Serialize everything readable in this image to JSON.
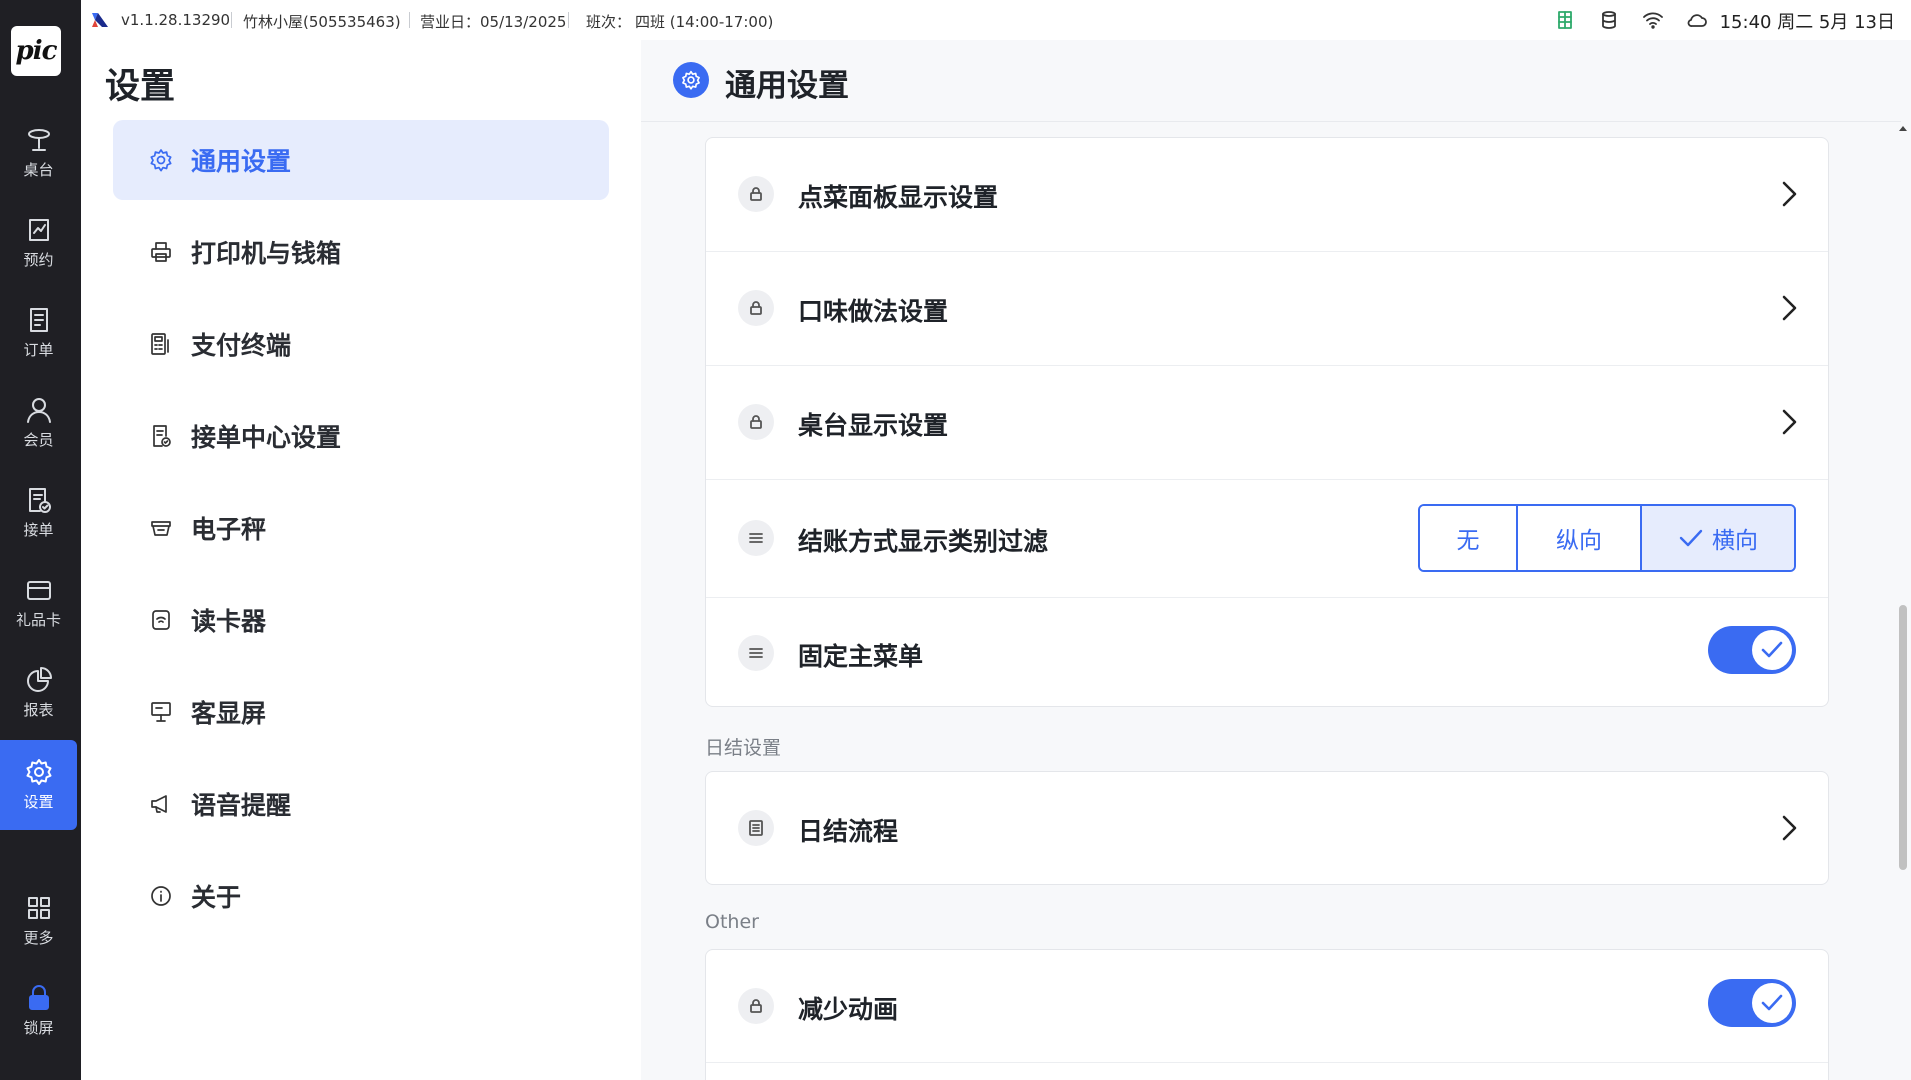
{
  "status_bar": {
    "version": "v1.1.28.13290",
    "store": "竹林小屋(505535463)",
    "business_day": "营业日：05/13/2025",
    "shift_label": "班次：",
    "shift_value": "四班 (14:00-17:00)",
    "datetime": "15:40 周二 5月 13日",
    "icons": [
      "spreadsheet-icon",
      "database-icon",
      "wifi-icon",
      "cloud-icon"
    ]
  },
  "rail": {
    "logo_text": "pic",
    "items": [
      {
        "label": "桌台",
        "icon": "table-icon"
      },
      {
        "label": "预约",
        "icon": "reservation-icon"
      },
      {
        "label": "订单",
        "icon": "order-icon"
      },
      {
        "label": "会员",
        "icon": "member-icon"
      },
      {
        "label": "接单",
        "icon": "accept-order-icon"
      },
      {
        "label": "礼品卡",
        "icon": "gift-card-icon"
      },
      {
        "label": "报表",
        "icon": "report-icon"
      },
      {
        "label": "设置",
        "icon": "gear-icon",
        "active": true
      },
      {
        "label": "更多",
        "icon": "grid-icon"
      },
      {
        "label": "锁屏",
        "icon": "lock-icon"
      }
    ]
  },
  "settings_nav": {
    "title": "设置",
    "items": [
      {
        "label": "通用设置",
        "icon": "gear-icon",
        "active": true
      },
      {
        "label": "打印机与钱箱",
        "icon": "printer-icon"
      },
      {
        "label": "支付终端",
        "icon": "pos-terminal-icon"
      },
      {
        "label": "接单中心设置",
        "icon": "order-center-icon"
      },
      {
        "label": "电子秤",
        "icon": "scale-icon"
      },
      {
        "label": "读卡器",
        "icon": "card-reader-icon"
      },
      {
        "label": "客显屏",
        "icon": "customer-display-icon"
      },
      {
        "label": "语音提醒",
        "icon": "megaphone-icon"
      },
      {
        "label": "关于",
        "icon": "info-icon"
      }
    ]
  },
  "content": {
    "title": "通用设置",
    "general_rows": [
      {
        "label": "点菜面板显示设置",
        "icon": "lock-icon",
        "control": "chevron"
      },
      {
        "label": "口味做法设置",
        "icon": "lock-icon",
        "control": "chevron"
      },
      {
        "label": "桌台显示设置",
        "icon": "lock-icon",
        "control": "chevron"
      },
      {
        "label": "结账方式显示类别过滤",
        "icon": "list-icon",
        "control": "segmented"
      },
      {
        "label": "固定主菜单",
        "icon": "list-icon",
        "control": "toggle",
        "on": true
      }
    ],
    "segmented": {
      "options": [
        "无",
        "纵向",
        "横向"
      ],
      "selected": "横向"
    },
    "day_end_section": "日结设置",
    "day_end_rows": [
      {
        "label": "日结流程",
        "icon": "document-icon",
        "control": "chevron"
      }
    ],
    "other_section": "Other",
    "other_rows": [
      {
        "label": "减少动画",
        "icon": "lock-icon",
        "control": "toggle",
        "on": true
      }
    ]
  },
  "colors": {
    "accent": "#3a6bf2",
    "rail_bg": "#1f1f24",
    "active_bg": "#e6ecfd",
    "content_bg": "#f7f8fa"
  }
}
